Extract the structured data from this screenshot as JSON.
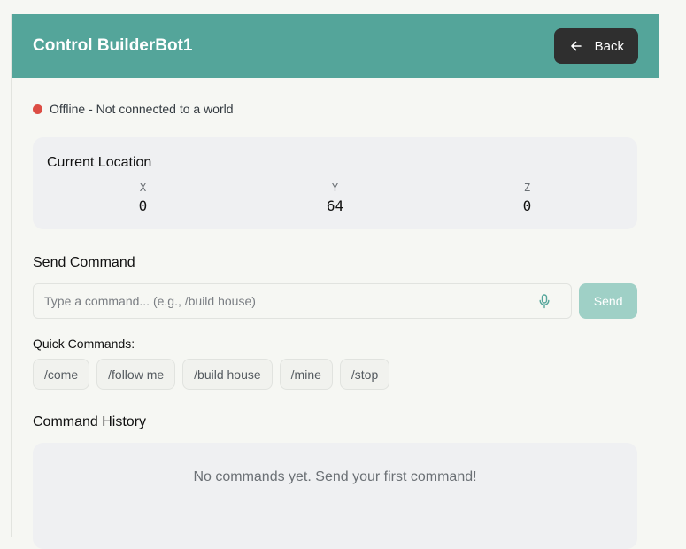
{
  "header": {
    "title": "Control BuilderBot1",
    "back_label": "Back",
    "color": "#54a59a"
  },
  "status": {
    "text": "Offline - Not connected to a world",
    "color": "#dc4d44"
  },
  "location": {
    "title": "Current Location",
    "x_label": "X",
    "x_value": "0",
    "y_label": "Y",
    "y_value": "64",
    "z_label": "Z",
    "z_value": "0"
  },
  "command": {
    "title": "Send Command",
    "placeholder": "Type a command... (e.g., /build house)",
    "value": "",
    "send_label": "Send",
    "icons": {
      "mic": "microphone-icon",
      "back": "arrow-left-icon"
    }
  },
  "quick": {
    "label": "Quick Commands:",
    "items": [
      "/come",
      "/follow me",
      "/build house",
      "/mine",
      "/stop"
    ]
  },
  "history": {
    "title": "Command History",
    "empty_text": "No commands yet. Send your first command!"
  }
}
